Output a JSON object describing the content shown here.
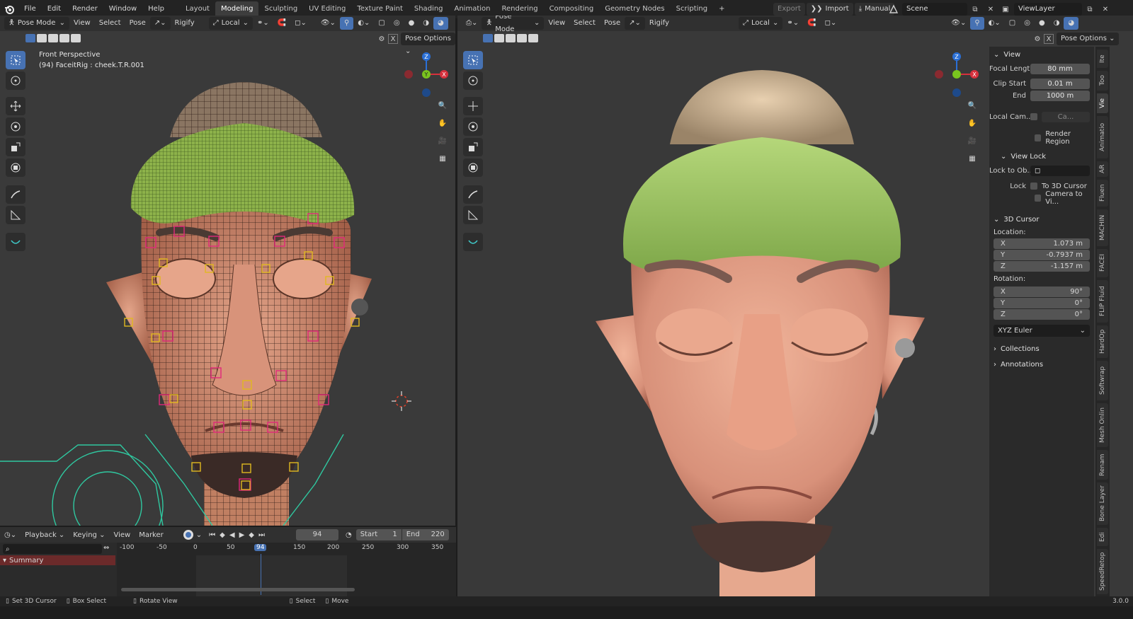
{
  "menu": {
    "items": [
      "File",
      "Edit",
      "Render",
      "Window",
      "Help"
    ]
  },
  "workspaces": {
    "tabs": [
      "Layout",
      "Modeling",
      "Sculpting",
      "UV Editing",
      "Texture Paint",
      "Shading",
      "Animation",
      "Rendering",
      "Compositing",
      "Geometry Nodes",
      "Scripting"
    ],
    "active": "Modeling"
  },
  "topright": {
    "export_label": "Export",
    "import_label": "Import",
    "manual_label": "Manual",
    "scene": "Scene",
    "view_layer": "ViewLayer"
  },
  "viewport_left": {
    "mode": "Pose Mode",
    "menus": [
      "View",
      "Select",
      "Pose"
    ],
    "rigify": "Rigify",
    "transform_orientation": "Local",
    "pose_options": "Pose Options",
    "title": "Front Perspective",
    "subtitle": "(94) FaceitRig : cheek.T.R.001"
  },
  "viewport_right": {
    "mode": "Pose Mode",
    "menus": [
      "View",
      "Select",
      "Pose"
    ],
    "rigify": "Rigify",
    "transform_orientation": "Local",
    "pose_options": "Pose Options"
  },
  "gizmo": {
    "x": "X",
    "y": "Y",
    "z": "Z"
  },
  "npanel": {
    "view_title": "View",
    "focal_label": "Focal Lengt",
    "focal_value": "80 mm",
    "clip_start_label": "Clip Start",
    "clip_start_value": "0.01 m",
    "clip_end_label": "End",
    "clip_end_value": "1000 m",
    "local_cam_label": "Local Cam...",
    "local_cam_value": "Ca...",
    "render_region_label": "Render Region",
    "view_lock_title": "View Lock",
    "lock_obj_label": "Lock to Ob...",
    "lock_label": "Lock",
    "to_cursor_label": "To 3D Cursor",
    "camera_view_label": "Camera to Vi...",
    "cursor_title": "3D Cursor",
    "location_label": "Location:",
    "loc": [
      {
        "axis": "X",
        "value": "1.073 m"
      },
      {
        "axis": "Y",
        "value": "-0.7937 m"
      },
      {
        "axis": "Z",
        "value": "-1.157 m"
      }
    ],
    "rotation_label": "Rotation:",
    "rot": [
      {
        "axis": "X",
        "value": "90°"
      },
      {
        "axis": "Y",
        "value": "0°"
      },
      {
        "axis": "Z",
        "value": "0°"
      }
    ],
    "rotation_mode": "XYZ Euler",
    "collections": "Collections",
    "annotations": "Annotations"
  },
  "ntabs": [
    "Ite",
    "Too",
    "Vie",
    "Animatio",
    "AR",
    "Fluen",
    "MACHIN",
    "FACEI",
    "FLIP Fluid",
    "HardOp",
    "Softwrap",
    "Mesh Onlin",
    "Renam",
    "Bone Layer",
    "Edi",
    "SpeedRetop"
  ],
  "timeline": {
    "menus": [
      "Playback",
      "Keying",
      "View",
      "Marker"
    ],
    "current_frame": "94",
    "start_label": "Start",
    "start_value": "1",
    "end_label": "End",
    "end_value": "220",
    "ruler": [
      "-100",
      "-50",
      "0",
      "50",
      "94",
      "150",
      "200",
      "250",
      "300",
      "350"
    ],
    "summary": "Summary"
  },
  "statusbar": {
    "items": [
      "Set 3D Cursor",
      "Box Select",
      "Rotate View",
      "Select",
      "Move"
    ],
    "version": "3.0.0"
  }
}
